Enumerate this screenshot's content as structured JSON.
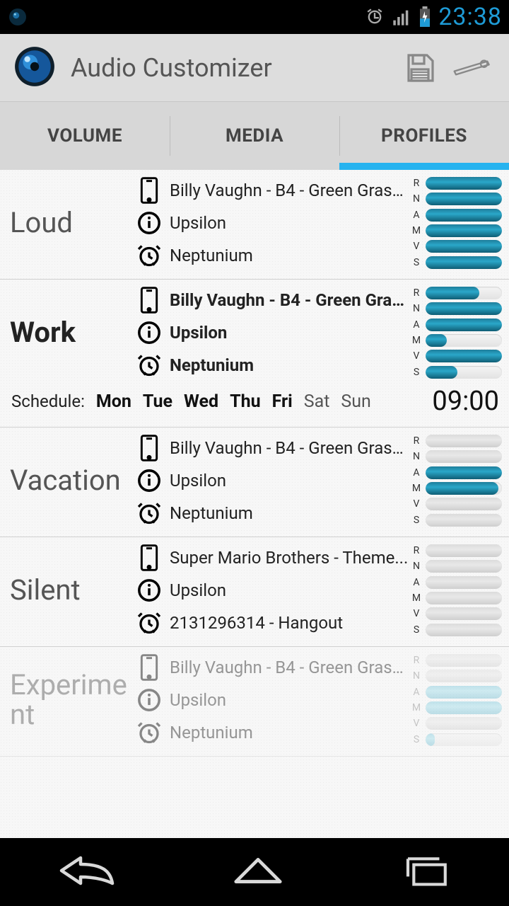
{
  "status": {
    "time": "23:38"
  },
  "appbar": {
    "title": "Audio Customizer"
  },
  "tabs": {
    "volume": "VOLUME",
    "media": "MEDIA",
    "profiles": "PROFILES",
    "active": "profiles"
  },
  "slider_labels": [
    "R",
    "N",
    "A",
    "M",
    "V",
    "S"
  ],
  "schedule": {
    "label": "Schedule:",
    "days": [
      "Mon",
      "Tue",
      "Wed",
      "Thu",
      "Fri",
      "Sat",
      "Sun"
    ],
    "active_days": [
      true,
      true,
      true,
      true,
      true,
      false,
      false
    ],
    "time": "09:00",
    "profile_index": 1
  },
  "profiles": [
    {
      "name": "Loud",
      "active": false,
      "disabled": false,
      "ringtone": "Billy Vaughn - B4 - Green Grass...",
      "notification": "Upsilon",
      "alarm": "Neptunium",
      "levels": [
        100,
        100,
        100,
        100,
        100,
        100
      ]
    },
    {
      "name": "Work",
      "active": true,
      "disabled": false,
      "ringtone": "Billy Vaughn - B4 - Green Grass...",
      "notification": "Upsilon",
      "alarm": "Neptunium",
      "levels": [
        70,
        100,
        100,
        28,
        100,
        42
      ]
    },
    {
      "name": "Vacation",
      "active": false,
      "disabled": false,
      "ringtone": "Billy Vaughn - B4 - Green Grass...",
      "notification": "Upsilon",
      "alarm": "Neptunium",
      "levels": [
        0,
        0,
        100,
        95,
        0,
        0
      ]
    },
    {
      "name": "Silent",
      "active": false,
      "disabled": false,
      "ringtone": "Super Mario Brothers - Theme...",
      "notification": "Upsilon",
      "alarm": "2131296314 - Hangout",
      "levels": [
        0,
        0,
        0,
        0,
        0,
        0
      ]
    },
    {
      "name": "Experiment",
      "active": false,
      "disabled": true,
      "ringtone": "Billy Vaughn - B4 - Green Grass...",
      "notification": "Upsilon",
      "alarm": "Neptunium",
      "levels": [
        0,
        0,
        100,
        100,
        0,
        12
      ]
    }
  ]
}
